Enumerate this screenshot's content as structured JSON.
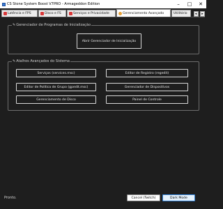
{
  "window": {
    "title": "CS Stone System Boost V7PRO - Armageddon Edition",
    "minimize_glyph": "–",
    "maximize_glyph": "□",
    "close_glyph": "✕"
  },
  "tabs": [
    {
      "label": "Latência e FPS",
      "icon": "red-square-icon",
      "active": false
    },
    {
      "label": "Disco e FS",
      "icon": "red-square-icon",
      "active": false
    },
    {
      "label": "Serviços e Privacidade",
      "icon": "red-square-icon",
      "active": false
    },
    {
      "label": "Gerenciamento Avançado",
      "icon": "orange-circle-icon",
      "active": true
    },
    {
      "label": "Utilitário",
      "icon": "",
      "active": false
    }
  ],
  "tab_scroll": {
    "left": "◂",
    "right": "▸"
  },
  "startup_group": {
    "legend_icon": "✎",
    "legend": "Gerenciador de Programas de Inicialização",
    "button_label": "Abrir Gerenciador de Inicialização"
  },
  "advanced_group": {
    "legend_icon": "✎",
    "legend": "Atalhos Avançados do Sistema",
    "buttons": [
      {
        "label": "Serviços (services.msc)"
      },
      {
        "label": "Editor de Registro (regedit)"
      },
      {
        "label": "Editor de Política de Grupo (gpedit.msc)"
      },
      {
        "label": "Gerenciador de Dispositivos"
      },
      {
        "label": "Gerenciamento de Disco"
      },
      {
        "label": "Painel de Controle"
      }
    ]
  },
  "footer": {
    "status": "Pronto.",
    "cancel_label": "Cancel (Twitch)",
    "darkmode_label": "Dark Mode"
  }
}
